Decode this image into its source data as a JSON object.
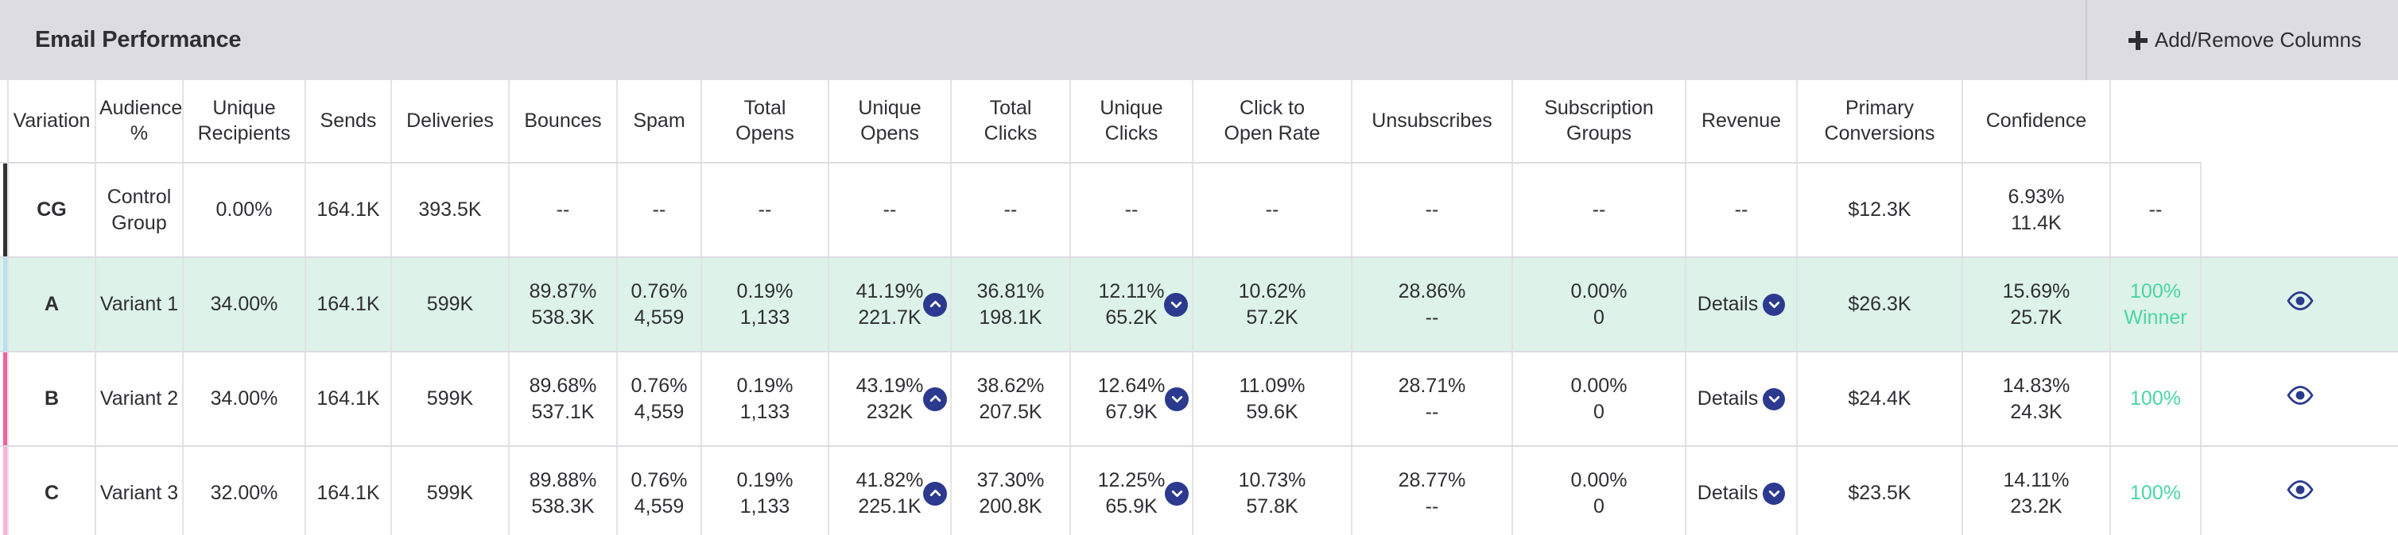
{
  "header": {
    "title": "Email Performance",
    "add_remove_label": "Add/Remove Columns",
    "plus_icon": "plus-icon"
  },
  "colors": {
    "header_bg": "#dcdce2",
    "row_highlight_bg": "#ddf2e9",
    "badge_blue": "#2b3a8f",
    "confidence_green": "#4ad6a3",
    "accent_control": "#333333",
    "accent_a": "#b8e0f5",
    "accent_b": "#f0609f",
    "accent_c": "#ffb0d4"
  },
  "columns": [
    {
      "key": "variation",
      "label": "Variation"
    },
    {
      "key": "audience_pct",
      "label": "Audience\n%",
      "line1": "Audience",
      "line2": "%"
    },
    {
      "key": "unique_recipients",
      "label": "Unique\nRecipients",
      "line1": "Unique",
      "line2": "Recipients"
    },
    {
      "key": "sends",
      "label": "Sends"
    },
    {
      "key": "deliveries",
      "label": "Deliveries"
    },
    {
      "key": "bounces",
      "label": "Bounces"
    },
    {
      "key": "spam",
      "label": "Spam"
    },
    {
      "key": "total_opens",
      "label": "Total\nOpens",
      "line1": "Total",
      "line2": "Opens"
    },
    {
      "key": "unique_opens",
      "label": "Unique\nOpens",
      "line1": "Unique",
      "line2": "Opens"
    },
    {
      "key": "total_clicks",
      "label": "Total\nClicks",
      "line1": "Total",
      "line2": "Clicks"
    },
    {
      "key": "unique_clicks",
      "label": "Unique\nClicks",
      "line1": "Unique",
      "line2": "Clicks"
    },
    {
      "key": "click_to_open_rate",
      "label": "Click to\nOpen Rate",
      "line1": "Click to",
      "line2": "Open Rate"
    },
    {
      "key": "unsubscribes",
      "label": "Unsubscribes"
    },
    {
      "key": "subscription_groups",
      "label": "Subscription\nGroups",
      "line1": "Subscription",
      "line2": "Groups"
    },
    {
      "key": "revenue",
      "label": "Revenue"
    },
    {
      "key": "primary_conversions",
      "label": "Primary\nConversions",
      "line1": "Primary",
      "line2": "Conversions"
    },
    {
      "key": "confidence",
      "label": "Confidence"
    }
  ],
  "rows": [
    {
      "id": "CG",
      "accent_color": "#333333",
      "highlight": false,
      "variation": "Control\nGroup",
      "variation_line1": "Control",
      "variation_line2": "Group",
      "audience_pct": "0.00%",
      "unique_recipients": "164.1K",
      "sends": "393.5K",
      "deliveries_pct": "--",
      "deliveries_count": "",
      "bounces_pct": "--",
      "bounces_count": "",
      "spam_pct": "--",
      "spam_count": "",
      "total_opens_pct": "--",
      "total_opens_count": "",
      "total_opens_trend": "",
      "unique_opens_pct": "--",
      "unique_opens_count": "",
      "total_clicks_pct": "--",
      "total_clicks_count": "",
      "total_clicks_trend": "",
      "unique_clicks_pct": "--",
      "unique_clicks_count": "",
      "click_to_open_pct": "--",
      "click_to_open_count": "",
      "unsubscribes_pct": "--",
      "unsubscribes_count": "",
      "subscription_groups": "--",
      "subscription_groups_has_control": false,
      "revenue": "$12.3K",
      "primary_conversions_pct": "6.93%",
      "primary_conversions_count": "11.4K",
      "confidence_value": "--",
      "confidence_note": "",
      "confidence_is_green": false,
      "has_eye": false
    },
    {
      "id": "A",
      "accent_color": "#b8e0f5",
      "highlight": true,
      "variation": "Variant 1",
      "variation_line1": "Variant 1",
      "variation_line2": "",
      "audience_pct": "34.00%",
      "unique_recipients": "164.1K",
      "sends": "599K",
      "deliveries_pct": "89.87%",
      "deliveries_count": "538.3K",
      "bounces_pct": "0.76%",
      "bounces_count": "4,559",
      "spam_pct": "0.19%",
      "spam_count": "1,133",
      "total_opens_pct": "41.19%",
      "total_opens_count": "221.7K",
      "total_opens_trend": "up",
      "unique_opens_pct": "36.81%",
      "unique_opens_count": "198.1K",
      "total_clicks_pct": "12.11%",
      "total_clicks_count": "65.2K",
      "total_clicks_trend": "down",
      "unique_clicks_pct": "10.62%",
      "unique_clicks_count": "57.2K",
      "click_to_open_pct": "28.86%",
      "click_to_open_count": "--",
      "unsubscribes_pct": "0.00%",
      "unsubscribes_count": "0",
      "subscription_groups": "Details",
      "subscription_groups_has_control": true,
      "revenue": "$26.3K",
      "primary_conversions_pct": "15.69%",
      "primary_conversions_count": "25.7K",
      "confidence_value": "100%",
      "confidence_note": "Winner",
      "confidence_is_green": true,
      "has_eye": true
    },
    {
      "id": "B",
      "accent_color": "#f0609f",
      "highlight": false,
      "variation": "Variant 2",
      "variation_line1": "Variant 2",
      "variation_line2": "",
      "audience_pct": "34.00%",
      "unique_recipients": "164.1K",
      "sends": "599K",
      "deliveries_pct": "89.68%",
      "deliveries_count": "537.1K",
      "bounces_pct": "0.76%",
      "bounces_count": "4,559",
      "spam_pct": "0.19%",
      "spam_count": "1,133",
      "total_opens_pct": "43.19%",
      "total_opens_count": "232K",
      "total_opens_trend": "up",
      "unique_opens_pct": "38.62%",
      "unique_opens_count": "207.5K",
      "total_clicks_pct": "12.64%",
      "total_clicks_count": "67.9K",
      "total_clicks_trend": "down",
      "unique_clicks_pct": "11.09%",
      "unique_clicks_count": "59.6K",
      "click_to_open_pct": "28.71%",
      "click_to_open_count": "--",
      "unsubscribes_pct": "0.00%",
      "unsubscribes_count": "0",
      "subscription_groups": "Details",
      "subscription_groups_has_control": true,
      "revenue": "$24.4K",
      "primary_conversions_pct": "14.83%",
      "primary_conversions_count": "24.3K",
      "confidence_value": "100%",
      "confidence_note": "",
      "confidence_is_green": true,
      "has_eye": true
    },
    {
      "id": "C",
      "accent_color": "#ffb0d4",
      "highlight": false,
      "variation": "Variant 3",
      "variation_line1": "Variant 3",
      "variation_line2": "",
      "audience_pct": "32.00%",
      "unique_recipients": "164.1K",
      "sends": "599K",
      "deliveries_pct": "89.88%",
      "deliveries_count": "538.3K",
      "bounces_pct": "0.76%",
      "bounces_count": "4,559",
      "spam_pct": "0.19%",
      "spam_count": "1,133",
      "total_opens_pct": "41.82%",
      "total_opens_count": "225.1K",
      "total_opens_trend": "up",
      "unique_opens_pct": "37.30%",
      "unique_opens_count": "200.8K",
      "total_clicks_pct": "12.25%",
      "total_clicks_count": "65.9K",
      "total_clicks_trend": "down",
      "unique_clicks_pct": "10.73%",
      "unique_clicks_count": "57.8K",
      "click_to_open_pct": "28.77%",
      "click_to_open_count": "--",
      "unsubscribes_pct": "0.00%",
      "unsubscribes_count": "0",
      "subscription_groups": "Details",
      "subscription_groups_has_control": true,
      "revenue": "$23.5K",
      "primary_conversions_pct": "14.11%",
      "primary_conversions_count": "23.2K",
      "confidence_value": "100%",
      "confidence_note": "",
      "confidence_is_green": true,
      "has_eye": true
    }
  ],
  "icons": {
    "trend_up": "chevron-up-icon",
    "trend_down": "chevron-down-icon",
    "details_chevron": "chevron-down-icon",
    "preview": "eye-icon"
  }
}
